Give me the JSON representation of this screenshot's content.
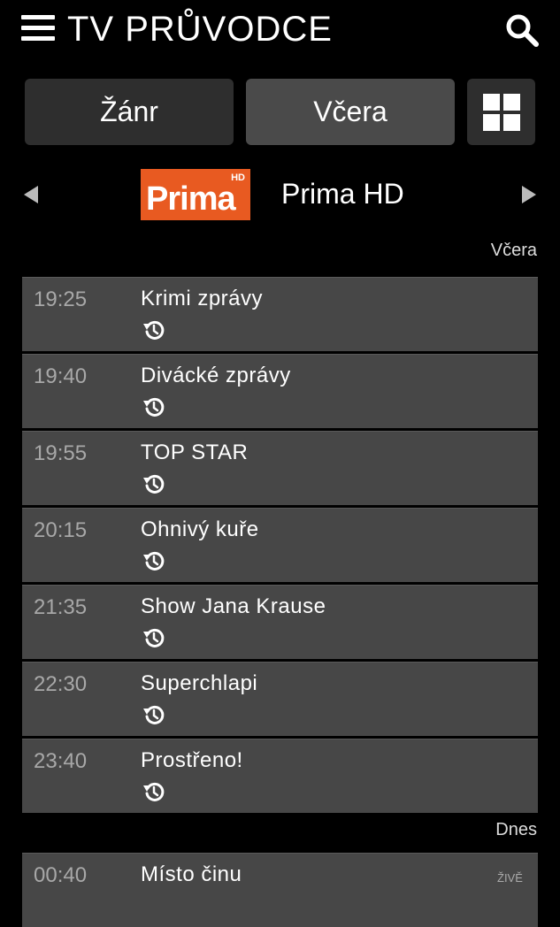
{
  "header": {
    "title": "TV PRŮVODCE",
    "menu_icon": "hamburger-menu-icon",
    "search_icon": "search-icon"
  },
  "filters": {
    "genre_label": "Žánr",
    "day_label": "Včera",
    "grid_icon": "grid-view-icon"
  },
  "channel": {
    "logo_text": "Prima",
    "logo_badge": "HD",
    "name": "Prima HD",
    "brand_color": "#e85a21",
    "prev_icon": "arrow-left-icon",
    "next_icon": "arrow-right-icon"
  },
  "sections": {
    "yesterday": "Včera",
    "today": "Dnes"
  },
  "programs": [
    {
      "time": "19:25",
      "title": "Krimi zprávy",
      "icon": "replay-icon"
    },
    {
      "time": "19:40",
      "title": "Divácké zprávy",
      "icon": "replay-icon"
    },
    {
      "time": "19:55",
      "title": "TOP STAR",
      "icon": "replay-icon"
    },
    {
      "time": "20:15",
      "title": "Ohnivý kuře",
      "icon": "replay-icon"
    },
    {
      "time": "21:35",
      "title": "Show Jana Krause",
      "icon": "replay-icon"
    },
    {
      "time": "22:30",
      "title": "Superchlapi",
      "icon": "replay-icon"
    },
    {
      "time": "23:40",
      "title": "Prostřeno!",
      "icon": "replay-icon"
    }
  ],
  "next_program": {
    "time": "00:40",
    "title": "Místo činu",
    "live_label": "ŽIVĚ"
  }
}
